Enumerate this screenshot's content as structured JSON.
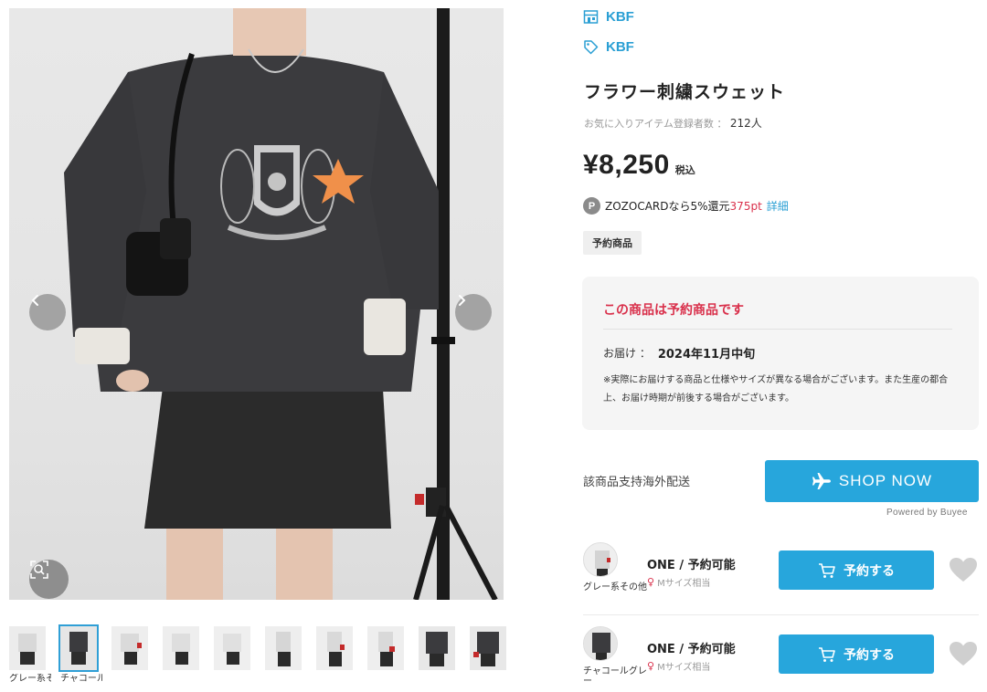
{
  "brands": [
    {
      "icon": "shop-icon",
      "label": "KBF"
    },
    {
      "icon": "tag-icon",
      "label": "KBF"
    }
  ],
  "product": {
    "title": "フラワー刺繍スウェット",
    "fav_label": "お気に入りアイテム登録者数 ：",
    "fav_count": "212人",
    "price": "¥8,250",
    "tax_label": "税込",
    "points": {
      "badge": "P",
      "text": "ZOZOCARDなら5%還元",
      "pt": "375pt",
      "detail": "詳細"
    },
    "tag": "予約商品"
  },
  "notice": {
    "title": "この商品は予約商品です",
    "delivery_label": "お届け ：",
    "delivery_date": "2024年11月中旬",
    "note": "※実際にお届けする商品と仕様やサイズが異なる場合がございます。また生産の都合上、お届け時期が前後する場合がございます。"
  },
  "overseas": {
    "label": "該商品支持海外配送",
    "button": "SHOP NOW",
    "powered": "Powered by Buyee"
  },
  "variants": [
    {
      "color": "グレー系その他",
      "size": "ONE / 予約可能",
      "fit": "Mサイズ相当",
      "button": "予約する"
    },
    {
      "color": "チャコールグレー",
      "size": "ONE / 予約可能",
      "fit": "Mサイズ相当",
      "button": "予約する"
    }
  ],
  "thumbnails": [
    {
      "caption": "グレー系その他",
      "selected": false
    },
    {
      "caption": "チャコールグレー",
      "selected": true
    },
    {
      "caption": "",
      "selected": false
    },
    {
      "caption": "",
      "selected": false
    },
    {
      "caption": "",
      "selected": false
    },
    {
      "caption": "",
      "selected": false
    },
    {
      "caption": "",
      "selected": false
    },
    {
      "caption": "",
      "selected": false
    },
    {
      "caption": "",
      "selected": false
    },
    {
      "caption": "",
      "selected": false
    }
  ],
  "colors": {
    "accent": "#27a6dc",
    "brand_text": "#2a9fd4",
    "alert_red": "#d9304b"
  }
}
